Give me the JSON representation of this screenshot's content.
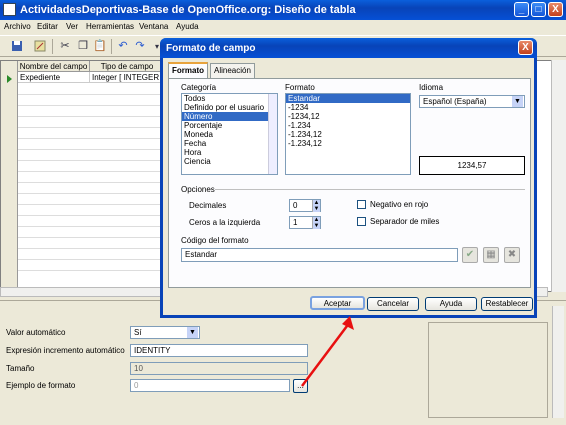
{
  "window": {
    "title": "ActividadesDeportivas-Base de OpenOffice.org: Diseño de tabla",
    "buttons": {
      "minimize": "_",
      "maximize": "□",
      "close": "X"
    }
  },
  "menu": [
    "Archivo",
    "Editar",
    "Ver",
    "Herramientas",
    "Ventana",
    "Ayuda"
  ],
  "table": {
    "headers": [
      "Nombre del campo",
      "Tipo de campo"
    ],
    "rows": [
      {
        "name": "Expediente",
        "type": "Integer [ INTEGER ]"
      }
    ]
  },
  "props": {
    "valor_auto_label": "Valor automático",
    "valor_auto_value": "Sí",
    "expresion_label": "Expresión incremento automático",
    "expresion_value": "IDENTITY",
    "tamano_label": "Tamaño",
    "tamano_value": "10",
    "ejemplo_label": "Ejemplo de formato",
    "ejemplo_value": "0",
    "ejemplo_button": "..."
  },
  "dialog": {
    "title": "Formato de campo",
    "close": "X",
    "tabs": [
      "Formato",
      "Alineación"
    ],
    "categoria_label": "Categoría",
    "categorias": [
      "Todos",
      "Definido por el usuario",
      "Número",
      "Porcentaje",
      "Moneda",
      "Fecha",
      "Hora",
      "Ciencia"
    ],
    "formato_label": "Formato",
    "formatos": [
      "Estandar",
      "-1234",
      "-1234,12",
      "-1.234",
      "-1.234,12",
      "-1.234,12"
    ],
    "idioma_label": "Idioma",
    "idioma_value": "Español (España)",
    "preview": "1234,57",
    "opciones_label": "Opciones",
    "decimales_label": "Decimales",
    "decimales_value": "0",
    "ceros_label": "Ceros a la izquierda",
    "ceros_value": "1",
    "negativo_label": "Negativo en rojo",
    "separador_label": "Separador de miles",
    "codigo_label": "Código del formato",
    "codigo_value": "Estandar",
    "buttons": {
      "aceptar": "Aceptar",
      "cancelar": "Cancelar",
      "ayuda": "Ayuda",
      "restablecer": "Restablecer"
    }
  },
  "colors": {
    "titlebar": "#0843b8",
    "selection": "#316ac5",
    "annotation_arrow": "#e81010"
  }
}
